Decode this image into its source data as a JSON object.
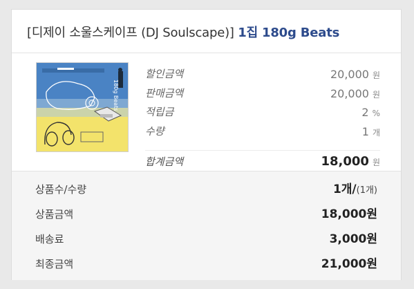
{
  "product": {
    "title_prefix": "[디제이 소울스케이프 (DJ Soulscape)]",
    "title_accent": "1집 180g Beats",
    "album_art_text": "180g Beats"
  },
  "details": [
    {
      "label": "할인금액",
      "value": "20,000",
      "unit": "원"
    },
    {
      "label": "판매금액",
      "value": "20,000",
      "unit": "원"
    },
    {
      "label": "적립금",
      "value": "2",
      "unit": "%"
    },
    {
      "label": "수량",
      "value": "1",
      "unit": "개"
    }
  ],
  "total": {
    "label": "합계금액",
    "value": "18,000",
    "unit": "원"
  },
  "summary": {
    "count": {
      "label": "상품수/수량",
      "value": "1개/",
      "sub": "(1개)"
    },
    "price": {
      "label": "상품금액",
      "value": "18,000원"
    },
    "shipping": {
      "label": "배송료",
      "value": "3,000원"
    },
    "final": {
      "label": "최종금액",
      "value": "21,000원"
    }
  },
  "colors": {
    "accent": "#2d4b8c",
    "summary_bg": "#f5f5f5",
    "page_bg": "#e9e9e9"
  }
}
